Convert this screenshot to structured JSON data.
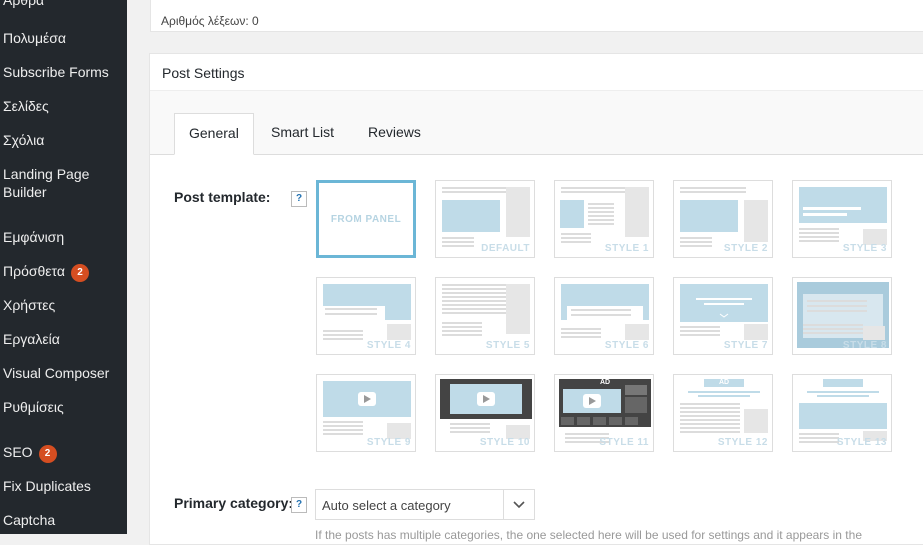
{
  "sidebar": {
    "items": [
      {
        "label": "Άρθρα"
      },
      {
        "label": "Πολυμέσα"
      },
      {
        "label": "Subscribe Forms"
      },
      {
        "label": "Σελίδες"
      },
      {
        "label": "Σχόλια"
      },
      {
        "label": "Landing Page"
      },
      {
        "label": "Builder"
      },
      {
        "label": "Εμφάνιση"
      },
      {
        "label": "Πρόσθετα",
        "badge": "2"
      },
      {
        "label": "Χρήστες"
      },
      {
        "label": "Εργαλεία"
      },
      {
        "label": "Visual Composer"
      },
      {
        "label": "Ρυθμίσεις"
      },
      {
        "label": "SEO",
        "badge": "2"
      },
      {
        "label": "Fix Duplicates"
      },
      {
        "label": "Captcha"
      }
    ]
  },
  "editor": {
    "word_count": "Αριθμός λέξεων: 0"
  },
  "post_settings": {
    "title": "Post Settings",
    "tabs": [
      {
        "label": "General"
      },
      {
        "label": "Smart List"
      },
      {
        "label": "Reviews"
      }
    ],
    "post_template_label": "Post template:",
    "help_glyph": "?",
    "templates": [
      {
        "label": "FROM PANEL"
      },
      {
        "label": "DEFAULT"
      },
      {
        "label": "STYLE 1"
      },
      {
        "label": "STYLE 2"
      },
      {
        "label": "STYLE 3"
      },
      {
        "label": "STYLE 4"
      },
      {
        "label": "STYLE 5"
      },
      {
        "label": "STYLE 6"
      },
      {
        "label": "STYLE 7"
      },
      {
        "label": "STYLE 8"
      },
      {
        "label": "STYLE 9"
      },
      {
        "label": "STYLE 10"
      },
      {
        "label": "STYLE 11"
      },
      {
        "label": "STYLE 12"
      },
      {
        "label": "STYLE 13"
      }
    ],
    "ad_text": "AD",
    "primary_category_label": "Primary category:",
    "primary_category_value": "Auto select a category",
    "primary_category_hint": "If the posts has multiple categories, the one selected here will be used for settings and it appears in the"
  },
  "colors": {
    "sidebar_bg": "#23282d",
    "badge": "#d54e21",
    "thumb_accent": "#bfdbe8",
    "selected_border": "#6bb6d6"
  }
}
